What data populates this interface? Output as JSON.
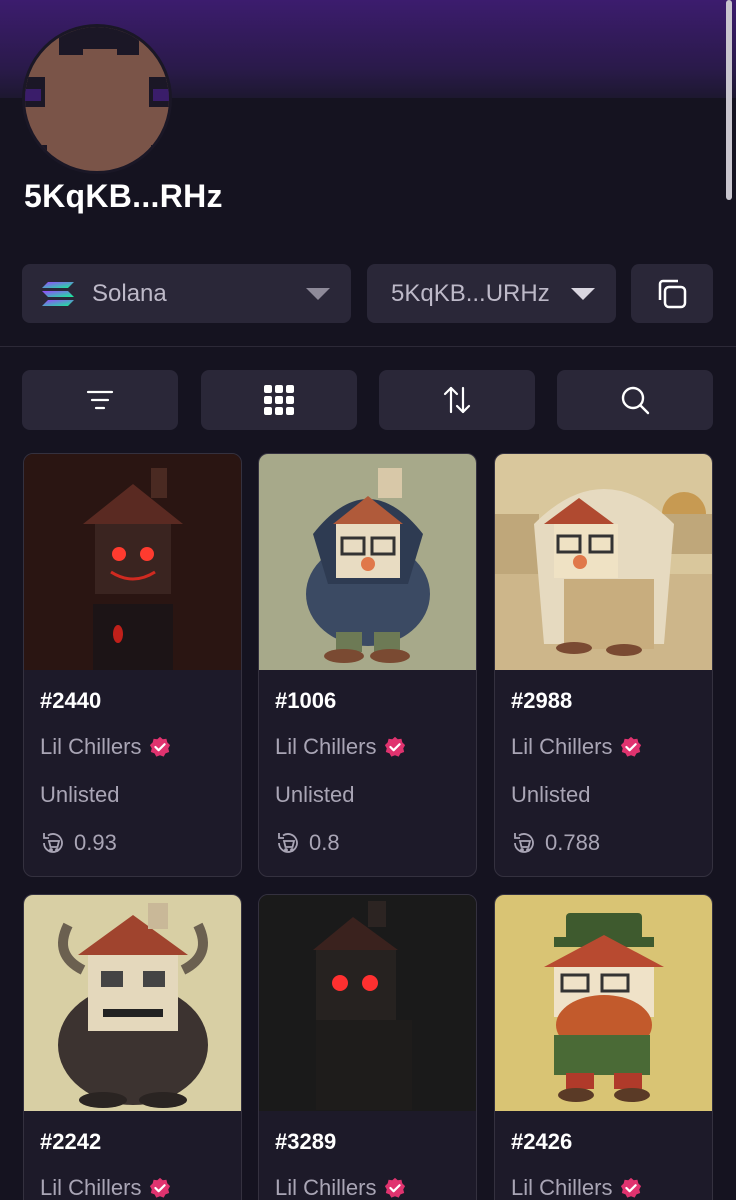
{
  "profile": {
    "username": "5KqKB...RHz"
  },
  "network_select": {
    "value": "Solana",
    "icon": "solana-logo-icon"
  },
  "wallet_select": {
    "value": "5KqKB...URHz"
  },
  "toolbar": {
    "filter_icon": "filter-icon",
    "grid_icon": "grid-view-icon",
    "sort_icon": "sort-icon",
    "search_icon": "search-icon"
  },
  "nfts": [
    {
      "title": "#2440",
      "collection": "Lil Chillers",
      "status": "Unlisted",
      "price": "0.93",
      "art": "dark-red-eyes"
    },
    {
      "title": "#1006",
      "collection": "Lil Chillers",
      "status": "Unlisted",
      "price": "0.8",
      "art": "hoodie"
    },
    {
      "title": "#2988",
      "collection": "Lil Chillers",
      "status": "Unlisted",
      "price": "0.788",
      "art": "desert-robe"
    },
    {
      "title": "#2242",
      "collection": "Lil Chillers",
      "status": "",
      "price": "",
      "art": "horned-beast"
    },
    {
      "title": "#3289",
      "collection": "Lil Chillers",
      "status": "",
      "price": "",
      "art": "shadow-red-eyes"
    },
    {
      "title": "#2426",
      "collection": "Lil Chillers",
      "status": "",
      "price": "",
      "art": "leprechaun"
    }
  ],
  "colors": {
    "background": "#151320",
    "card": "#1d1a29",
    "button": "#2a2738",
    "verified_badge": "#e0336f"
  }
}
